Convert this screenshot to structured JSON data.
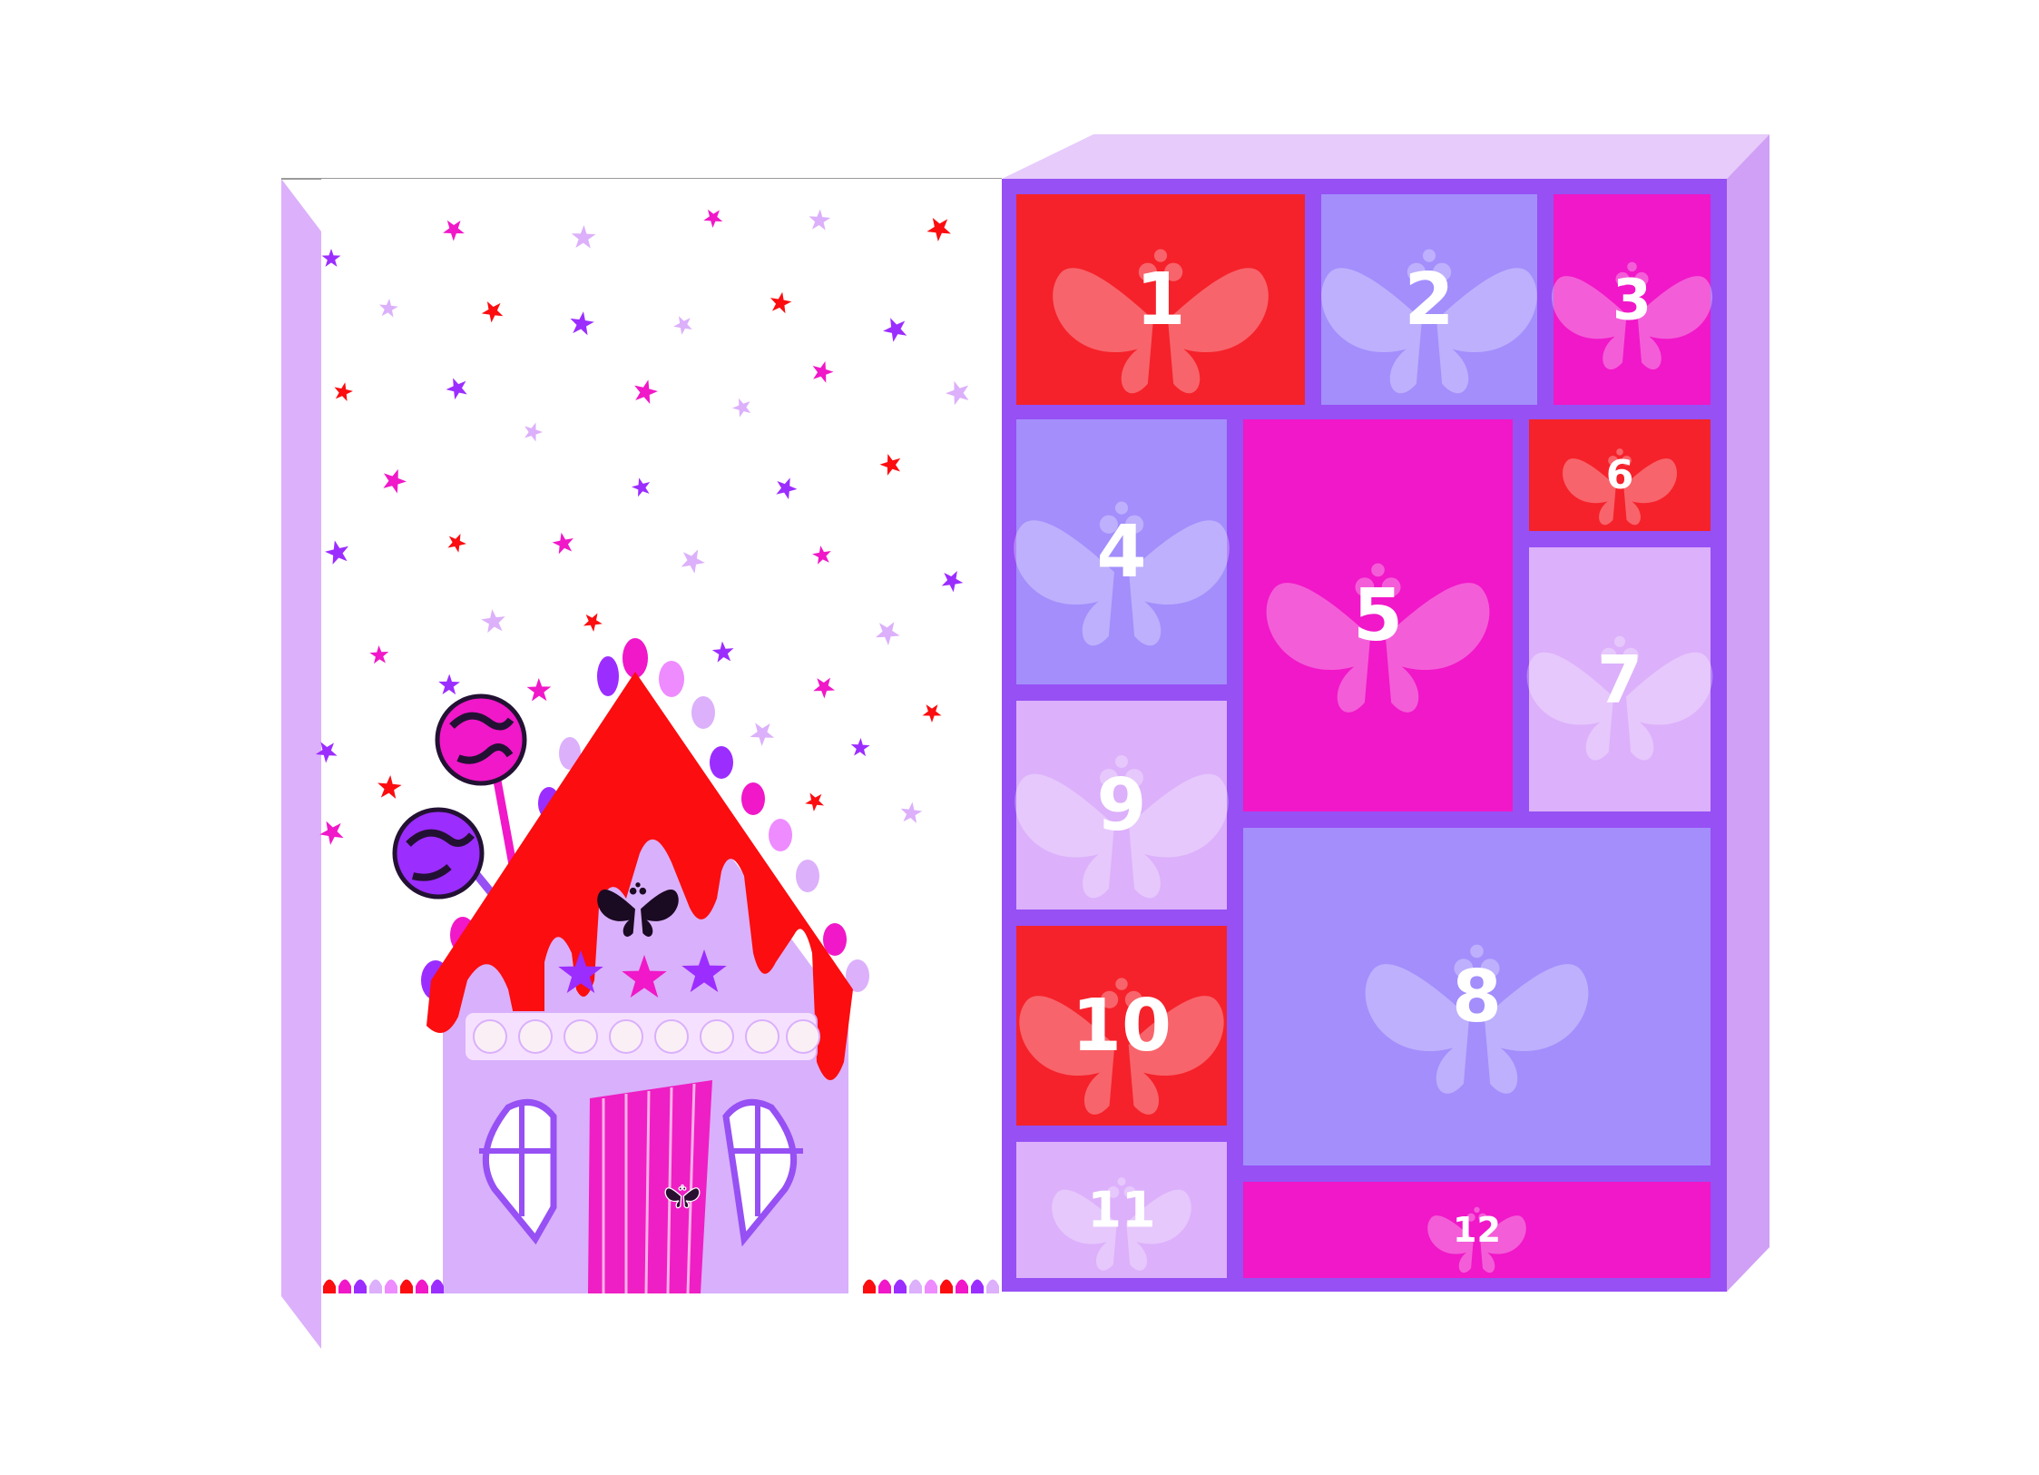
{
  "calendar": {
    "doors": [
      {
        "number": "1",
        "color": "#f5222b"
      },
      {
        "number": "2",
        "color": "#a38efc"
      },
      {
        "number": "3",
        "color": "#f018c8"
      },
      {
        "number": "4",
        "color": "#a38efc"
      },
      {
        "number": "5",
        "color": "#f018c8"
      },
      {
        "number": "6",
        "color": "#f5222b"
      },
      {
        "number": "7",
        "color": "#dcb0fb"
      },
      {
        "number": "8",
        "color": "#a38efc"
      },
      {
        "number": "9",
        "color": "#dcb0fb"
      },
      {
        "number": "10",
        "color": "#f5222b"
      },
      {
        "number": "11",
        "color": "#dcb0fb"
      },
      {
        "number": "12",
        "color": "#f018c8"
      }
    ],
    "colors": {
      "box_frame": "#9650f4",
      "box_top": "#e6cbfb",
      "box_side": "#cfa0f5",
      "lid_panel": "#dcb0fb",
      "roof": "#fb0d10",
      "house_wall": "#d9b0fb",
      "door": "#ee1fc4"
    },
    "icons": {
      "door_watermark": "butterfly-logo-icon",
      "house_logo": "butterfly-logo-icon",
      "house_door_emblem": "butterfly-icon",
      "sky": "star-icon",
      "candy": "lollipop-icon"
    }
  }
}
